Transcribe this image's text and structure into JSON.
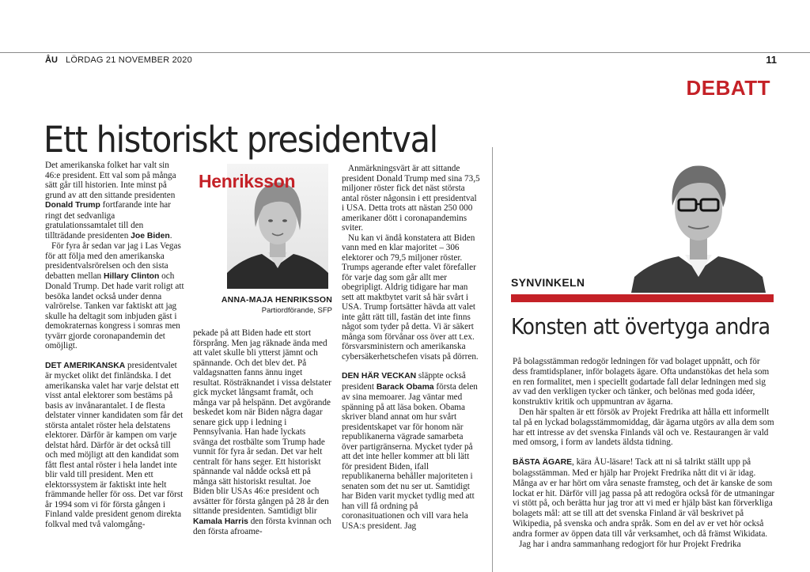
{
  "header": {
    "logo": "ÅU",
    "date": "LÖRDAG 21 NOVEMBER 2020",
    "page_number": "11",
    "section": "DEBATT"
  },
  "article": {
    "headline": "Ett historiskt presidentval",
    "photo_overlay_text": "Henriksson",
    "author_name": "ANNA-MAJA HENRIKSSON",
    "author_role": "Partiordförande, SFP",
    "col1": [
      "Det amerikanska folket har valt sin 46:e president. Ett val som på många sätt går till historien. Inte minst på grund av att den sittande presidenten",
      "Donald Trump",
      "fortfarande inte har ringt det sedvanliga gratulationssamtalet till den tillträdande presidenten",
      "Joe Biden",
      ".",
      "För fyra år sedan var jag i Las Vegas för att följa med den amerikanska presidentvalsrörelsen och den sista debatten mellan",
      "Hillary Clinton",
      "och Donald Trump. Det hade varit roligt att besöka landet också under denna valrörelse. Tanken var faktiskt att jag skulle ha deltagit som inbjuden gäst i demokraternas kongress i somras men tyvärr gjorde coronapandemin det omöjligt.",
      "DET AMERIKANSKA",
      "presidentvalet är mycket olikt det finländska. I det amerikanska valet har varje delstat ett visst antal elektorer som bestäms på basis av invånarantalet. I de flesta delstater vinner kandidaten som får det största antalet röster hela delstatens elektorer. Därför är kampen om varje delstat hård. Därför är det också till och med möjligt att den kandidat som fått flest antal röster i hela landet inte blir vald till president. Men ett elektorssystem är faktiskt inte helt främmande heller för oss. Det var först år 1994 som vi för första gången i Finland valde president genom direkta folkval med två valomgång-"
    ],
    "col2": [
      "pekade på att Biden hade ett stort försprång. Men jag räknade ända med att valet skulle bli ytterst jämnt och spännande. Och det blev det. På valdagsnatten fanns ännu inget resultat. Rösträknandet i vissa delstater gick mycket långsamt framåt, och många var på helspänn. Det avgörande beskedet kom när Biden några dagar senare gick upp i ledning i Pennsylvania. Han hade lyckats svänga det rostbälte som Trump hade vunnit för fyra år sedan. Det var helt centralt för hans seger. Ett historiskt spännande val nådde också ett på många sätt historiskt resultat. Joe Biden blir USAs 46:e president och avsätter för första gången på 28 år den sittande presidenten. Samtidigt blir",
      "Kamala Harris",
      "den första kvinnan och den första afroame-"
    ],
    "col3": [
      "Anmärkningsvärt är att sittande president Donald Trump med sina 73,5 miljoner röster fick det näst största antal röster någonsin i ett presidentval i USA. Detta trots att nästan 250 000 amerikaner dött i coronapandemins sviter.",
      "Nu kan vi ändå konstatera att Biden vann med en klar majoritet – 306 elektorer och 79,5 miljoner röster. Trumps agerande efter valet förefaller för varje dag som går allt mer obegripligt. Aldrig tidigare har man sett att maktbytet varit så här svårt i USA. Trump fortsätter hävda att valet inte gått rätt till, fastän det inte finns något som tyder på detta. Vi är säkert många som förvånar oss över att t.ex. försvarsministern och amerikanska cybersäkerhetschefen visats på dörren.",
      "DEN HÄR VECKAN",
      "släppte också president",
      "Barack Obama",
      "första delen av sina memoarer. Jag väntar med spänning på att läsa boken. Obama skriver bland annat om hur svårt presidentskapet var för honom när republikanerna vägrade samarbeta över partigränserna. Mycket tyder på att det inte heller kommer att bli lätt för president Biden, ifall republikanerna behåller majoriteten i senaten som det nu ser ut. Samtidigt har Biden varit mycket tydlig med att han vill få ordning på coronasituationen och vill vara hela USA:s president. Jag"
    ]
  },
  "synvinkeln": {
    "label": "SYNVINKELN",
    "headline": "Konsten att övertyga andra",
    "p1": "På bolagsstämman redogör ledningen för vad bolaget uppnått, och för dess framtidsplaner, inför bolagets ägare. Ofta undanstökas det hela som en ren formalitet, men i speciellt godartade fall delar ledningen med sig av vad den verkligen tycker och tänker, och belönas med goda idéer, konstruktiv kritik och uppmuntran av ägarna.",
    "p2": "Den här spalten är ett försök av Projekt Fredrika att hålla ett informellt tal på en lyckad bolagsstämmomiddag, där ägarna utgörs av alla dem som har ett intresse av det svenska Finlands väl och ve. Restaurangen är vald med omsorg, i form av landets äldsta tidning.",
    "lead": "BÄSTA ÄGARE",
    "p3": ", kära ÅU-läsare! Tack att ni så talrikt ställt upp på bolagsstämman. Med er hjälp har Projekt Fredrika nått dit vi är idag. Många av er har hört om våra senaste framsteg, och det är kanske de som lockat er hit. Därför vill jag passa på att redogöra också för de utmaningar vi stött på, och berätta hur jag tror att vi med er hjälp bäst kan förverkliga bolagets mål: att se till att det svenska Finland är väl beskrivet på Wikipedia, på svenska och andra språk. Som en del av er vet hör också andra former av öppen data till vår verksamhet, och då främst Wikidata.",
    "p4": "Jag har i andra sammanhang redogjort för hur Projekt Fredrika"
  }
}
